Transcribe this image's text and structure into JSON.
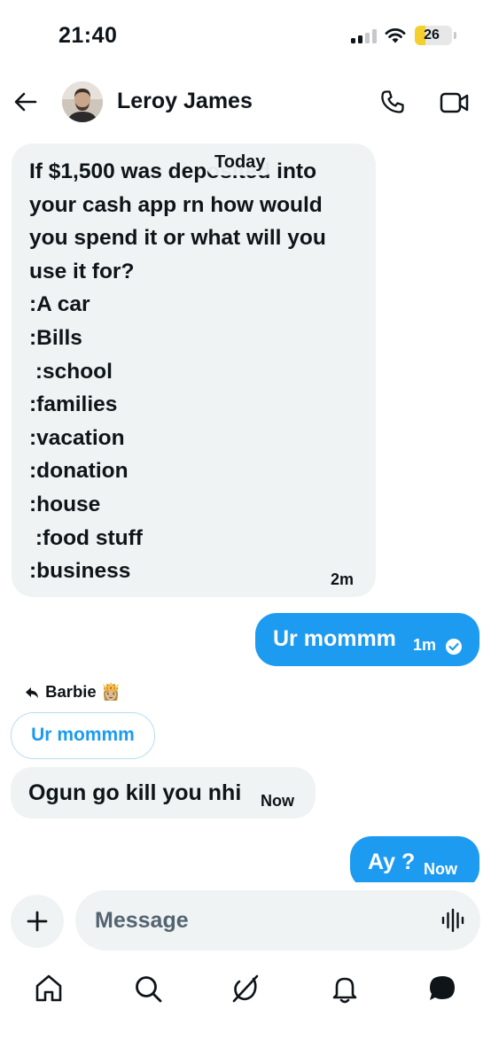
{
  "status_bar": {
    "time": "21:40",
    "battery": "26"
  },
  "header": {
    "contact_name": "Leroy James"
  },
  "date_separator": "Today",
  "messages": {
    "incoming_1": {
      "text": "If $1,500 was deposited into\nyour cash app rn how would\nyou spend it or what will you\nuse it for?\n:A car\n:Bills\n :school\n:families\n:vacation\n:donation\n:house\n :food stuff\n:business",
      "time": "2m"
    },
    "outgoing_1": {
      "text": "Ur mommm",
      "time": "1m"
    },
    "reply_to": {
      "label": "Barbie 👸🏼",
      "quoted": "Ur mommm"
    },
    "incoming_2": {
      "text": "Ogun go kill you nhi",
      "time": "Now"
    },
    "outgoing_2": {
      "text": "Ay ?",
      "time": "Now"
    }
  },
  "composer": {
    "placeholder": "Message"
  },
  "colors": {
    "accent": "#1d9bf0",
    "bubble_incoming": "#eff3f4",
    "text": "#0f1419",
    "muted": "#536471"
  },
  "icons": [
    "back-arrow-icon",
    "phone-icon",
    "video-icon",
    "plus-icon",
    "voice-icon",
    "home-icon",
    "search-icon",
    "grok-icon",
    "bell-icon",
    "messages-icon",
    "check-icon"
  ]
}
